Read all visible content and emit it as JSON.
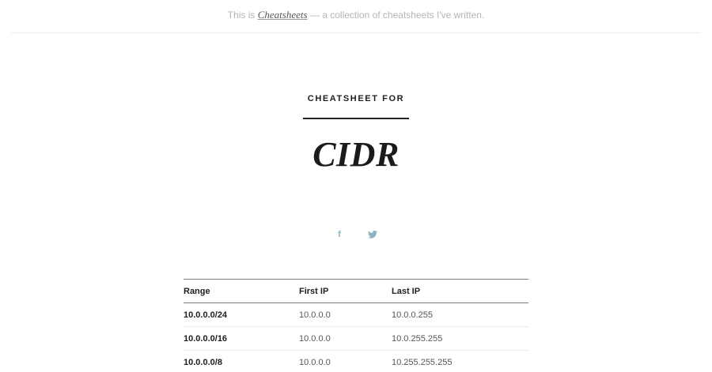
{
  "header": {
    "prefix": "This is",
    "site_name": "Cheatsheets",
    "suffix": "— a collection of cheatsheets I've written."
  },
  "hero": {
    "kicker": "CHEATSHEET FOR",
    "title": "CIDR"
  },
  "social": {
    "facebook_glyph": "f",
    "icons": [
      "facebook-icon",
      "twitter-icon"
    ],
    "icon_color": "#8fb1c2"
  },
  "table": {
    "headers": [
      "Range",
      "First IP",
      "Last IP"
    ],
    "rows": [
      [
        "10.0.0.0/24",
        "10.0.0.0",
        "10.0.0.255"
      ],
      [
        "10.0.0.0/16",
        "10.0.0.0",
        "10.0.255.255"
      ],
      [
        "10.0.0.0/8",
        "10.0.0.0",
        "10.255.255.255"
      ]
    ]
  }
}
